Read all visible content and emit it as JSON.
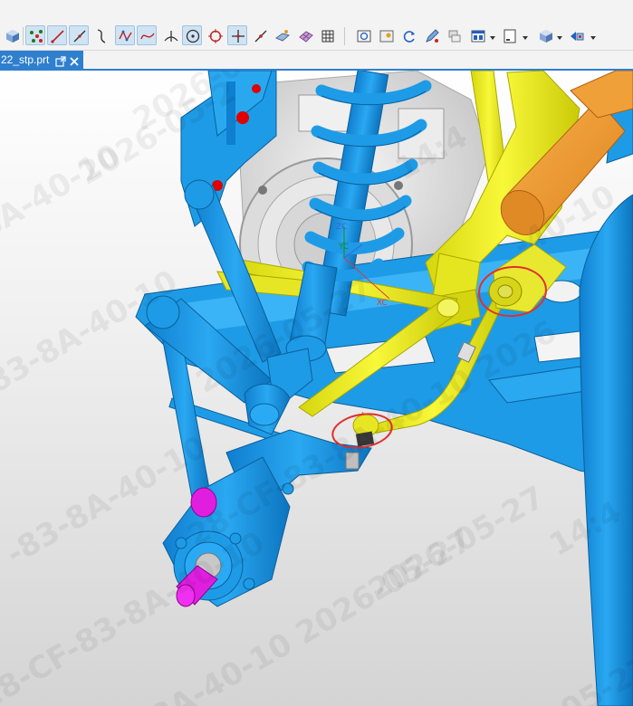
{
  "toolbar": {
    "buttons": [
      {
        "name": "view-cube-icon"
      },
      {
        "name": "point-set-icon"
      },
      {
        "name": "line-icon"
      },
      {
        "name": "line-diagonal-icon"
      },
      {
        "name": "curve-icon"
      },
      {
        "name": "studio-spline-icon"
      },
      {
        "name": "fit-spline-icon"
      },
      {
        "name": "perpendicular-icon"
      },
      {
        "name": "circle-center-icon"
      },
      {
        "name": "target-circle-icon"
      },
      {
        "name": "cross-point-icon"
      },
      {
        "name": "line-point-icon"
      },
      {
        "name": "surface-icon"
      },
      {
        "name": "mesh-icon"
      },
      {
        "name": "grid-icon"
      },
      {
        "name": "zoom-fit-icon"
      },
      {
        "name": "image-icon"
      },
      {
        "name": "refresh-icon"
      },
      {
        "name": "edit-pen-icon"
      },
      {
        "name": "layers-icon"
      },
      {
        "name": "layout-icon"
      },
      {
        "name": "page-icon"
      },
      {
        "name": "shading-cube-icon"
      },
      {
        "name": "display-icon"
      }
    ]
  },
  "tab": {
    "label": "22_stp.prt"
  },
  "viewport": {
    "watermarks": [
      "2026-05-27  14:4",
      "2026-05-2",
      "8A-40-10",
      "-40-10",
      "83-8A-40-10",
      "2026-05-27",
      "-83-8A-40-10",
      "14:4",
      "28-CF-83-8A-40-10",
      "2026-05-27",
      "-05-27",
      "8A-40-10  2026-05-27",
      "28-CF-83-8A-40-10  2026",
      "14:4"
    ],
    "axis_labels": {
      "zc": "ZC",
      "yc": "YC",
      "xc": "XC"
    }
  },
  "colors": {
    "frame_blue": "#1e9be6",
    "arm_yellow": "#ecec1a",
    "damper_orange": "#f09a30",
    "hub_magenta": "#e01ee0",
    "highlight_red": "#e03030",
    "tab_blue": "#2f7fcf"
  }
}
